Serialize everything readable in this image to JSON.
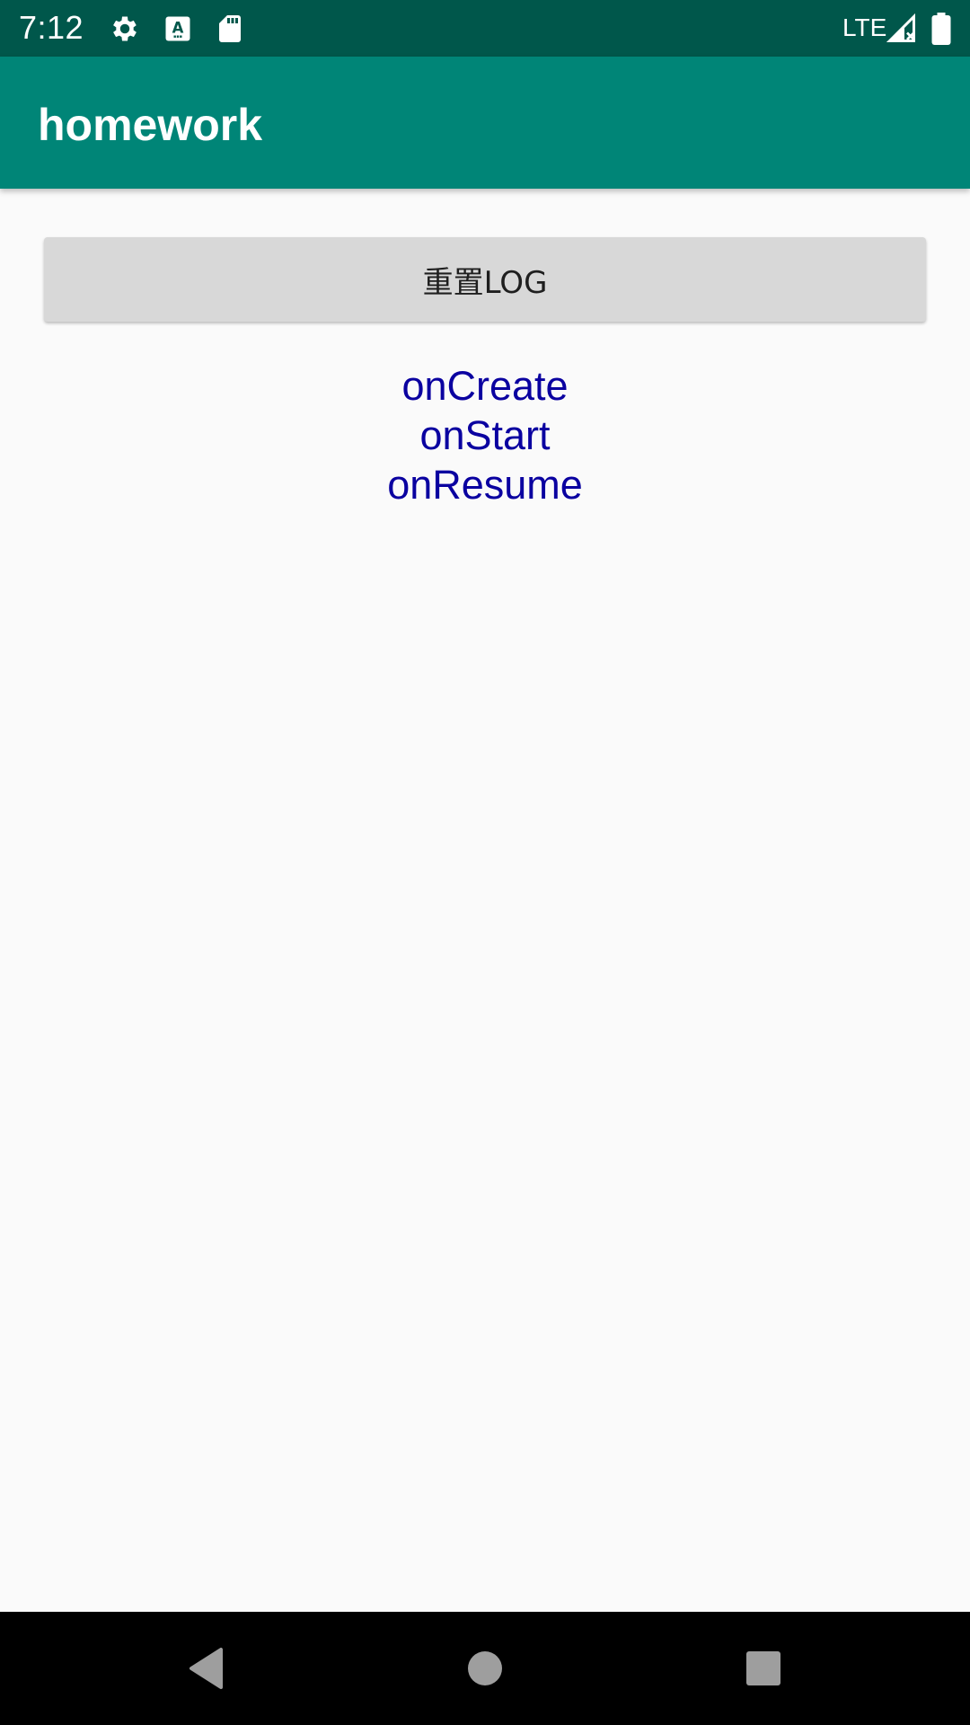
{
  "status_bar": {
    "time": "7:12",
    "network": "LTE",
    "icons": [
      "settings-gear-icon",
      "accessibility-text-icon",
      "sd-card-icon",
      "signal-icon",
      "battery-icon"
    ]
  },
  "app_bar": {
    "title": "homework",
    "color": "#008577",
    "status_color": "#00574b"
  },
  "main": {
    "reset_button_label": "重置LOG",
    "log_lines": [
      "onCreate",
      "onStart",
      "onResume"
    ],
    "log_color": "#0a00a0"
  },
  "nav_bar": {
    "icons": [
      "back-icon",
      "home-icon",
      "recents-icon"
    ]
  }
}
